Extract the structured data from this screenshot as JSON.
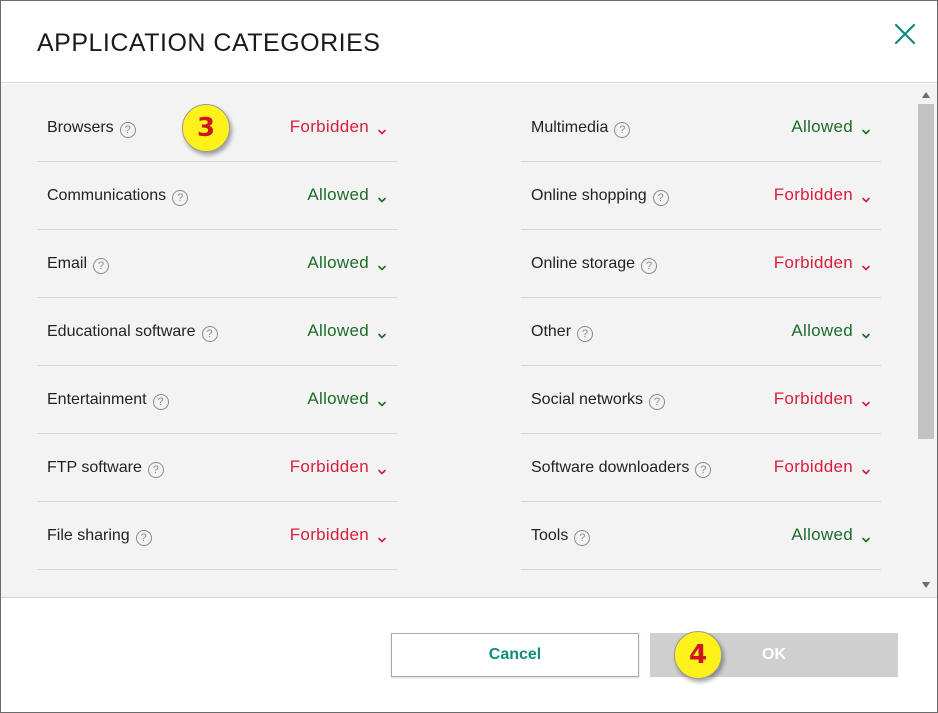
{
  "dialog": {
    "title": "APPLICATION CATEGORIES",
    "close_icon": "close-icon",
    "accent_color": "#118a7e"
  },
  "colors": {
    "allowed": "#1e6b2a",
    "forbidden": "#d71f3c",
    "annotation_badge": "#fff21a"
  },
  "categories_left": [
    {
      "label": "Browsers",
      "status": "Forbidden"
    },
    {
      "label": "Communications",
      "status": "Allowed"
    },
    {
      "label": "Email",
      "status": "Allowed"
    },
    {
      "label": "Educational software",
      "status": "Allowed"
    },
    {
      "label": "Entertainment",
      "status": "Allowed"
    },
    {
      "label": "FTP software",
      "status": "Forbidden"
    },
    {
      "label": "File sharing",
      "status": "Forbidden"
    }
  ],
  "categories_right": [
    {
      "label": "Multimedia",
      "status": "Allowed"
    },
    {
      "label": "Online shopping",
      "status": "Forbidden"
    },
    {
      "label": "Online storage",
      "status": "Forbidden"
    },
    {
      "label": "Other",
      "status": "Allowed"
    },
    {
      "label": "Social networks",
      "status": "Forbidden"
    },
    {
      "label": "Software downloaders",
      "status": "Forbidden"
    },
    {
      "label": "Tools",
      "status": "Allowed"
    }
  ],
  "help_glyph": "?",
  "annotations": {
    "badge_3": "3",
    "badge_4": "4"
  },
  "footer": {
    "cancel_label": "Cancel",
    "ok_label": "OK"
  }
}
